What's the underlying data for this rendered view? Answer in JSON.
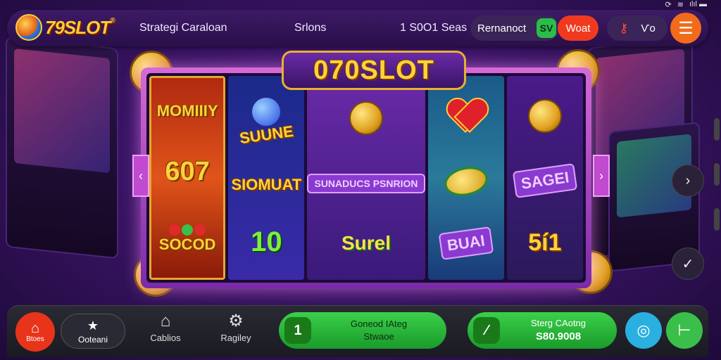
{
  "status": {
    "icons": [
      "sync-icon",
      "wifi-icon",
      "signal-icon",
      "battery-icon"
    ],
    "text": "ılıl ▬"
  },
  "header": {
    "logo_text": "79SLOT",
    "logo_mark": "®",
    "nav": [
      "Strategi Caraloan",
      "Srlons",
      "1 S0O1 Seas"
    ],
    "remember_label": "Rernanoct",
    "remember_tag": "SV",
    "red_button": "Woat",
    "key_icon": "key-icon",
    "group_label": "Ѵo",
    "menu_icon": "hamburger-icon"
  },
  "game": {
    "banner": "070SLOT",
    "reels": [
      {
        "name": "reel-1",
        "symbols": [
          "MOMIIIY",
          "607",
          "SOCOD"
        ]
      },
      {
        "name": "reel-2",
        "symbols": [
          "SUUNE",
          "SIOMUAT",
          "10"
        ]
      },
      {
        "name": "reel-3",
        "symbols": [
          "coin-stack",
          "SUNADUCS PSNRION",
          "Surel"
        ]
      },
      {
        "name": "reel-4",
        "symbols": [
          "heart",
          "gold-leaf",
          "BUAI"
        ]
      },
      {
        "name": "reel-5",
        "symbols": [
          "coin-stack",
          "SAGEI",
          "5í1"
        ]
      }
    ],
    "accent": "#ffd23a",
    "frame_color": "#d66ad6"
  },
  "side": {
    "next_icon": "chevron-right-icon",
    "check_icon": "check-icon"
  },
  "bottom": {
    "home_label": "Btoes",
    "featured_label": "Ooteani",
    "casinos_label": "Cablios",
    "rapley_label": "Ragiley",
    "promo": {
      "icon_text": "1",
      "line1": "Goneod IAteg",
      "line2": "Stwaoe"
    },
    "balance": {
      "icon_text": "⁄",
      "line1": "Sterg CAotng",
      "line2": "S80.9008"
    },
    "blue_icon": "ring-icon",
    "green_icon": "arrow-right-icon"
  }
}
